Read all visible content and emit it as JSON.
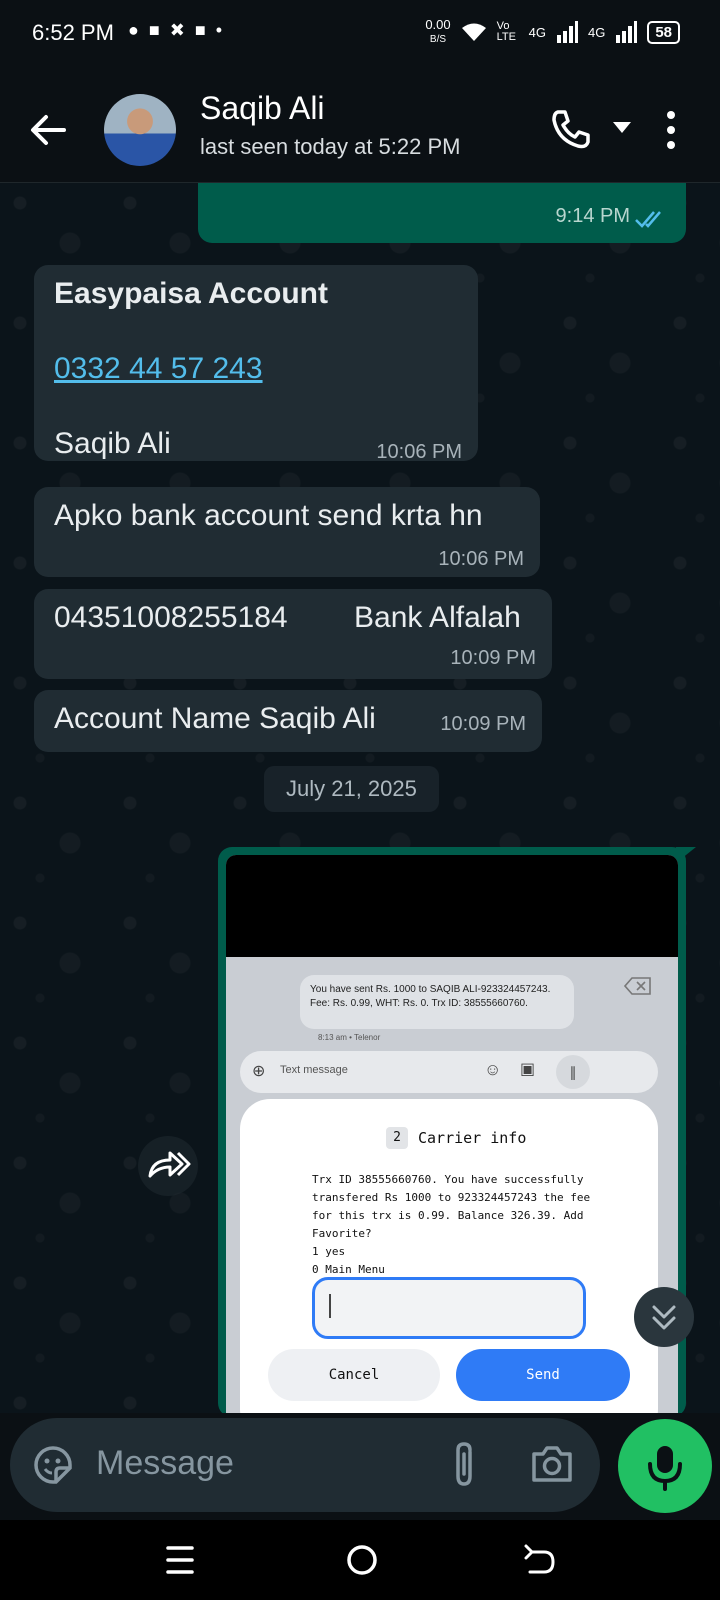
{
  "status_bar": {
    "time": "6:52 PM",
    "net_speed": "0.00",
    "net_unit": "B/S",
    "volte": "Vo LTE",
    "net_1": "4G",
    "net_2": "4G",
    "battery": "58"
  },
  "header": {
    "contact_name": "Saqib Ali",
    "last_seen": "last seen today at 5:22 PM"
  },
  "messages": [
    {
      "dir": "out",
      "time": "9:14 PM",
      "status": "read"
    },
    {
      "dir": "in",
      "title": "Easypaisa Account",
      "link": "0332 44 57 243",
      "name": "Saqib Ali",
      "time": "10:06 PM"
    },
    {
      "dir": "in",
      "text": "Apko bank account send  krta hn",
      "time": "10:06 PM"
    },
    {
      "dir": "in",
      "account": "04351008255184",
      "bank": "Bank Alfalah",
      "time": "10:09 PM"
    },
    {
      "dir": "in",
      "text": "Account Name Saqib Ali",
      "time": "10:09 PM"
    }
  ],
  "date_chip": "July 21, 2025",
  "image_message": {
    "sms_text_1": "You have sent Rs. 1000 to SAQIB ALI-923324457243.",
    "sms_text_2": "Fee: Rs. 0.99, WHT: Rs. 0. Trx ID: 38555660760.",
    "sms_meta": "8:13 am • Telenor",
    "text_placeholder": "Text message",
    "dialog_badge": "2",
    "dialog_title": "Carrier info",
    "dialog_line_1": "Trx ID 38555660760. You have successfully",
    "dialog_line_2": "transfered Rs 1000 to 923324457243 the fee",
    "dialog_line_3": "for this trx is 0.99. Balance 326.39. Add",
    "dialog_line_4": "Favorite?",
    "dialog_line_5": "1 yes",
    "dialog_line_6": "0 Main Menu",
    "cancel": "Cancel",
    "send": "Send"
  },
  "composer": {
    "placeholder": "Message"
  },
  "colors": {
    "incoming_bubble": "#202c33",
    "outgoing_bubble": "#005c4b",
    "link": "#53bdeb",
    "mic_button": "#21c063"
  }
}
